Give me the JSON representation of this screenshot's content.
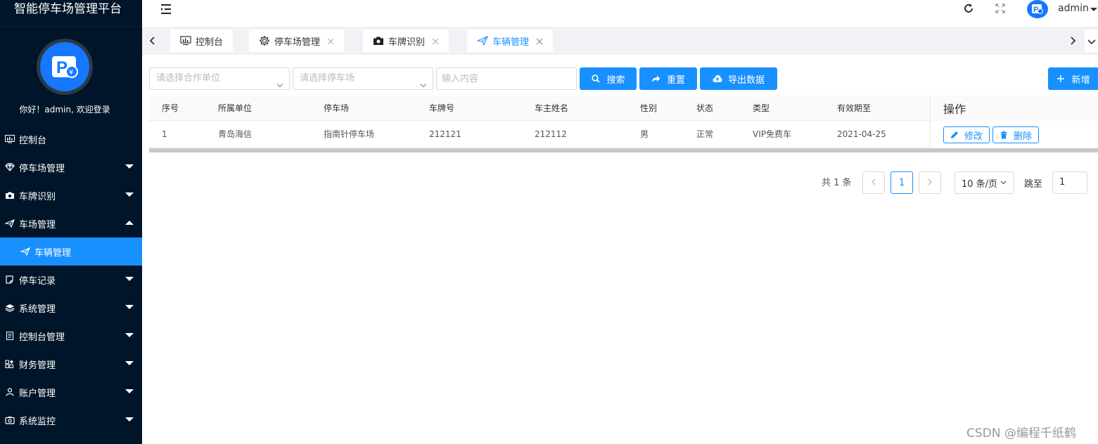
{
  "sidebar": {
    "title": "智能停车场管理平台",
    "welcome": "你好！admin, 欢迎登录",
    "items": [
      {
        "label": "控制台",
        "icon": "dashboard-icon",
        "has_caret": false
      },
      {
        "label": "停车场管理",
        "icon": "diamond-icon",
        "has_caret": true
      },
      {
        "label": "车牌识别",
        "icon": "camera-icon",
        "has_caret": true
      },
      {
        "label": "车场管理",
        "icon": "send-icon",
        "has_caret": true,
        "expanded": true
      },
      {
        "label": "车辆管理",
        "icon": "send-icon",
        "sub": true,
        "active": true
      },
      {
        "label": "停车记录",
        "icon": "note-icon",
        "has_caret": true
      },
      {
        "label": "系统管理",
        "icon": "layers-icon",
        "has_caret": true
      },
      {
        "label": "控制台管理",
        "icon": "document-icon",
        "has_caret": true
      },
      {
        "label": "财务管理",
        "icon": "grid-icon",
        "has_caret": true
      },
      {
        "label": "账户管理",
        "icon": "user-icon",
        "has_caret": true
      },
      {
        "label": "系统监控",
        "icon": "monitor-camera-icon",
        "has_caret": true
      }
    ]
  },
  "header": {
    "username": "admin"
  },
  "tabs": [
    {
      "label": "控制台",
      "icon": "monitor-icon",
      "closable": false
    },
    {
      "label": "停车场管理",
      "icon": "gear-icon",
      "closable": true
    },
    {
      "label": "车牌识别",
      "icon": "camera-icon",
      "closable": true
    },
    {
      "label": "车辆管理",
      "icon": "send-icon",
      "closable": true,
      "active": true
    }
  ],
  "filters": {
    "partner_placeholder": "请选择合作单位",
    "parking_placeholder": "请选择停车场",
    "keyword_placeholder": "输入内容",
    "search_label": "搜索",
    "reset_label": "重置",
    "export_label": "导出数据",
    "add_label": "新增"
  },
  "table": {
    "columns": [
      "序号",
      "所属单位",
      "停车场",
      "车牌号",
      "车主姓名",
      "性别",
      "状态",
      "类型",
      "有效期至",
      "操作"
    ],
    "rows": [
      [
        "1",
        "青岛海信",
        "指南针停车场",
        "212121",
        "212112",
        "男",
        "正常",
        "VIP免费车",
        "2021-04-25"
      ]
    ],
    "edit_label": "修改",
    "delete_label": "删除"
  },
  "pagination": {
    "total": "共 1 条",
    "current_page": "1",
    "page_size": "10 条/页",
    "jump_label": "跳至",
    "jump_value": "1"
  },
  "watermark": "CSDN @编程千纸鹤",
  "colors": {
    "sidebar_bg": "#001529",
    "accent": "#1890ff"
  }
}
